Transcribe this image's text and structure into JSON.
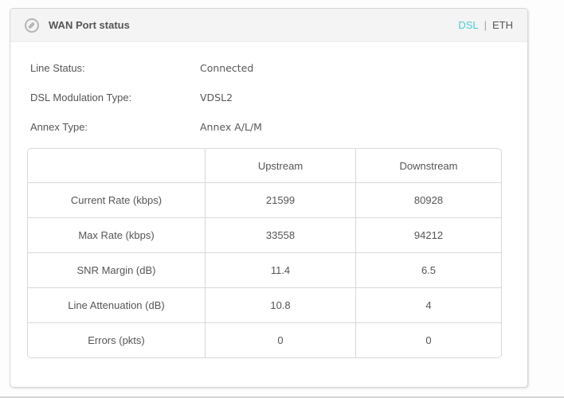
{
  "panel": {
    "title": "WAN Port status",
    "tab_separator": "|",
    "tabs": [
      {
        "label": "DSL",
        "active": true
      },
      {
        "label": "ETH",
        "active": false
      }
    ]
  },
  "info": {
    "rows": [
      {
        "label": "Line Status:",
        "value": "Connected"
      },
      {
        "label": "DSL Modulation Type:",
        "value": "VDSL2"
      },
      {
        "label": "Annex Type:",
        "value": "Annex A/L/M"
      }
    ]
  },
  "table": {
    "headers": {
      "metric": "",
      "upstream": "Upstream",
      "downstream": "Downstream"
    },
    "rows": [
      {
        "label": "Current Rate (kbps)",
        "upstream": "21599",
        "downstream": "80928"
      },
      {
        "label": "Max Rate (kbps)",
        "upstream": "33558",
        "downstream": "94212"
      },
      {
        "label": "SNR Margin (dB)",
        "upstream": "11.4",
        "downstream": "6.5"
      },
      {
        "label": "Line Attenuation (dB)",
        "upstream": "10.8",
        "downstream": "4"
      },
      {
        "label": "Errors (pkts)",
        "upstream": "0",
        "downstream": "0"
      }
    ]
  },
  "icons": {
    "header_icon": "wan-status-dial-icon"
  },
  "colors": {
    "accent": "#4acbd6",
    "text": "#555555",
    "table_border": "#d9d9d9",
    "header_bg": "#f4f4f4",
    "panel_border": "#d6d6d6"
  }
}
